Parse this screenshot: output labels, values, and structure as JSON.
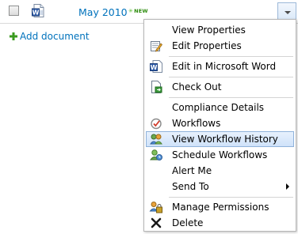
{
  "row": {
    "title": "May 2010",
    "new_badge": "NEW",
    "dropdown_icon": "chevron-down-icon"
  },
  "add_document": {
    "label": "Add document",
    "icon": "plus-icon"
  },
  "menu": {
    "items": [
      {
        "label": "View Properties",
        "icon": ""
      },
      {
        "label": "Edit Properties",
        "icon": "edit-properties-icon"
      },
      {
        "label": "Edit in Microsoft Word",
        "icon": "word-icon"
      },
      {
        "label": "Check Out",
        "icon": "check-out-icon"
      },
      {
        "label": "Compliance Details",
        "icon": ""
      },
      {
        "label": "Workflows",
        "icon": "workflows-icon"
      },
      {
        "label": "View Workflow History",
        "icon": "workflow-history-icon",
        "highlighted": true
      },
      {
        "label": "Schedule Workflows",
        "icon": "schedule-workflows-icon"
      },
      {
        "label": "Alert Me",
        "icon": ""
      },
      {
        "label": "Send To",
        "icon": "",
        "submenu": true
      },
      {
        "label": "Manage Permissions",
        "icon": "manage-permissions-icon"
      },
      {
        "label": "Delete",
        "icon": "delete-icon"
      }
    ]
  },
  "colors": {
    "link": "#0072bc",
    "highlight_bg": "#cfe2f9",
    "highlight_border": "#8fb2db"
  }
}
